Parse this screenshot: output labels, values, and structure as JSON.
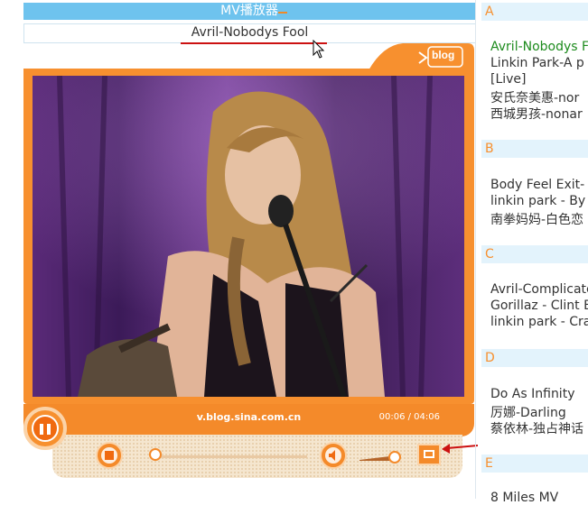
{
  "player": {
    "header_title": "MV播放器",
    "song_title": "Avril-Nobodys Fool",
    "url": "v.blog.sina.com.cn",
    "time": "00:06 / 04:06",
    "logo_text": "blog",
    "progress": 0.02,
    "volume": 0.85
  },
  "colors": {
    "accent": "#f7902f",
    "header": "#6ec3ee",
    "current_item": "#1d8b1d"
  },
  "playlist": [
    {
      "letter": "A",
      "items": [
        "Avril-Nobodys F",
        "Linkin Park-A p",
        "[Live]",
        "安氏奈美惠-nor",
        "西城男孩-nonar"
      ]
    },
    {
      "letter": "B",
      "items": [
        "Body Feel Exit-",
        "linkin park - By N",
        "南拳妈妈-白色恋"
      ]
    },
    {
      "letter": "C",
      "items": [
        "Avril-Complicate",
        "Gorillaz - Clint E",
        "linkin park - Cra"
      ]
    },
    {
      "letter": "D",
      "items": [
        "Do As Infinity",
        "厉娜-Darling",
        "蔡依林-独占神话"
      ]
    },
    {
      "letter": "E",
      "items": [
        "8 Miles MV"
      ]
    }
  ]
}
